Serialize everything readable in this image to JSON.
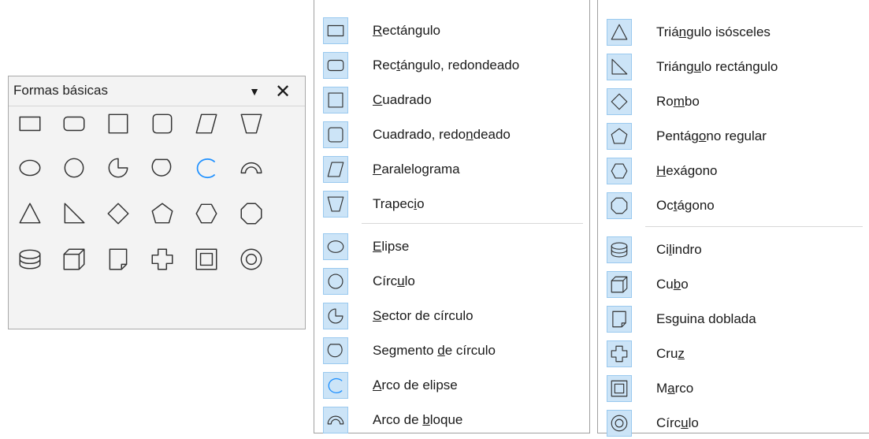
{
  "toolbar": {
    "title": "Formas básicas",
    "menu_arrow": "▼",
    "close_glyph": "✕"
  },
  "menu_left": {
    "groups": [
      [
        {
          "pre": "",
          "ul": "R",
          "post": "ectángulo",
          "icon": "rectangle-icon"
        },
        {
          "pre": "Rec",
          "ul": "t",
          "post": "ángulo, redondeado",
          "icon": "rounded-rectangle-icon"
        },
        {
          "pre": "",
          "ul": "C",
          "post": "uadrado",
          "icon": "square-icon"
        },
        {
          "pre": "Cuadrado, redo",
          "ul": "n",
          "post": "deado",
          "icon": "rounded-square-icon"
        },
        {
          "pre": "",
          "ul": "P",
          "post": "aralelograma",
          "icon": "parallelogram-icon"
        },
        {
          "pre": "Trapec",
          "ul": "i",
          "post": "o",
          "icon": "trapezoid-icon"
        }
      ],
      [
        {
          "pre": "",
          "ul": "E",
          "post": "lipse",
          "icon": "ellipse-icon"
        },
        {
          "pre": "Círc",
          "ul": "u",
          "post": "lo",
          "icon": "circle-icon"
        },
        {
          "pre": "",
          "ul": "S",
          "post": "ector de círculo",
          "icon": "circle-pie-icon"
        },
        {
          "pre": "Segmento ",
          "ul": "d",
          "post": "e círculo",
          "icon": "circle-segment-icon"
        },
        {
          "pre": "",
          "ul": "A",
          "post": "rco de elipse",
          "icon": "ellipse-arc-icon"
        },
        {
          "pre": "Arco de ",
          "ul": "b",
          "post": "loque",
          "icon": "block-arc-icon"
        }
      ]
    ]
  },
  "menu_right": {
    "groups": [
      [
        {
          "pre": "Triá",
          "ul": "n",
          "post": "gulo isósceles",
          "icon": "isosceles-triangle-icon"
        },
        {
          "pre": "Triáng",
          "ul": "u",
          "post": "lo rectángulo",
          "icon": "right-triangle-icon"
        },
        {
          "pre": "Ro",
          "ul": "m",
          "post": "bo",
          "icon": "diamond-icon"
        },
        {
          "pre": "Pentág",
          "ul": "o",
          "post": "no regular",
          "icon": "pentagon-icon"
        },
        {
          "pre": "",
          "ul": "H",
          "post": "exágono",
          "icon": "hexagon-icon"
        },
        {
          "pre": "Oc",
          "ul": "t",
          "post": "ágono",
          "icon": "octagon-icon"
        }
      ],
      [
        {
          "pre": "Ci",
          "ul": "l",
          "post": "indro",
          "icon": "cylinder-icon"
        },
        {
          "pre": "Cu",
          "ul": "b",
          "post": "o",
          "icon": "cube-icon"
        },
        {
          "pre": "Es",
          "ul": "g",
          "post": "uina doblada",
          "icon": "folded-corner-icon"
        },
        {
          "pre": "Cru",
          "ul": "z",
          "post": "",
          "icon": "cross-icon"
        },
        {
          "pre": "M",
          "ul": "a",
          "post": "rco",
          "icon": "frame-icon"
        },
        {
          "pre": "Círc",
          "ul": "u",
          "post": "lo",
          "icon": "ring-icon"
        }
      ]
    ]
  },
  "toolbar_grid": [
    [
      "rectangle-icon",
      "rounded-rectangle-icon",
      "square-icon",
      "rounded-square-icon",
      "parallelogram-icon",
      "trapezoid-icon"
    ],
    [
      "ellipse-icon",
      "circle-icon",
      "circle-pie-icon",
      "circle-segment-icon",
      "ellipse-arc-icon",
      "block-arc-icon"
    ],
    [
      "isosceles-triangle-icon",
      "right-triangle-icon",
      "diamond-icon",
      "pentagon-icon",
      "hexagon-icon",
      "octagon-icon"
    ],
    [
      "cylinder-icon",
      "cube-icon",
      "folded-corner-icon",
      "cross-icon",
      "frame-icon",
      "ring-icon"
    ]
  ],
  "colors": {
    "icon_stroke": "#333333",
    "arc_accent": "#1e90ff",
    "highlight_bg": "#cce4f7",
    "highlight_border": "#99c9ef"
  }
}
